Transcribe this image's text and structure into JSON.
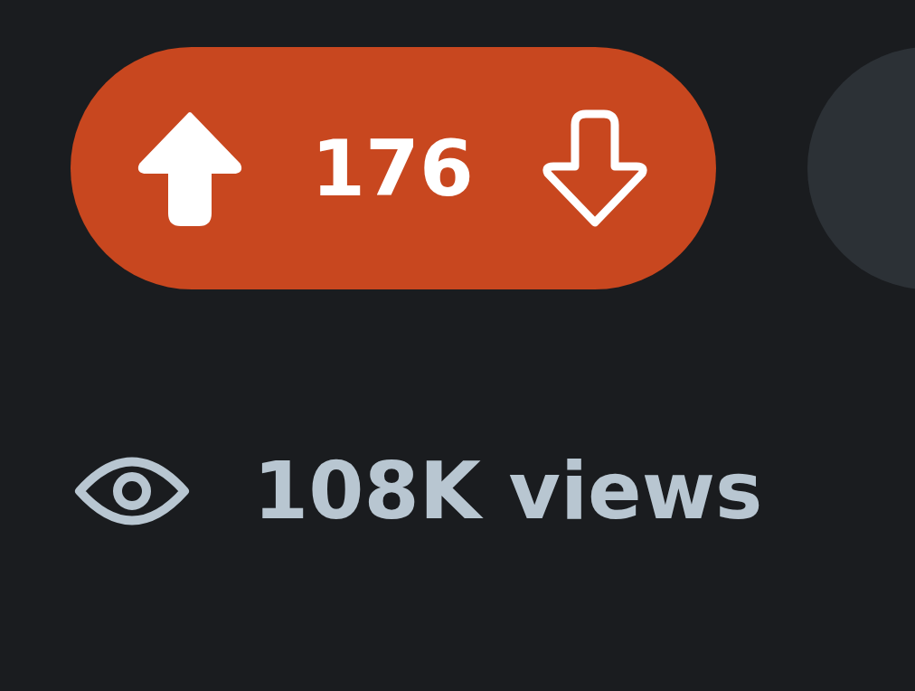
{
  "vote": {
    "score": "176",
    "upvoted": true,
    "downvoted": false
  },
  "views": "108K views"
}
